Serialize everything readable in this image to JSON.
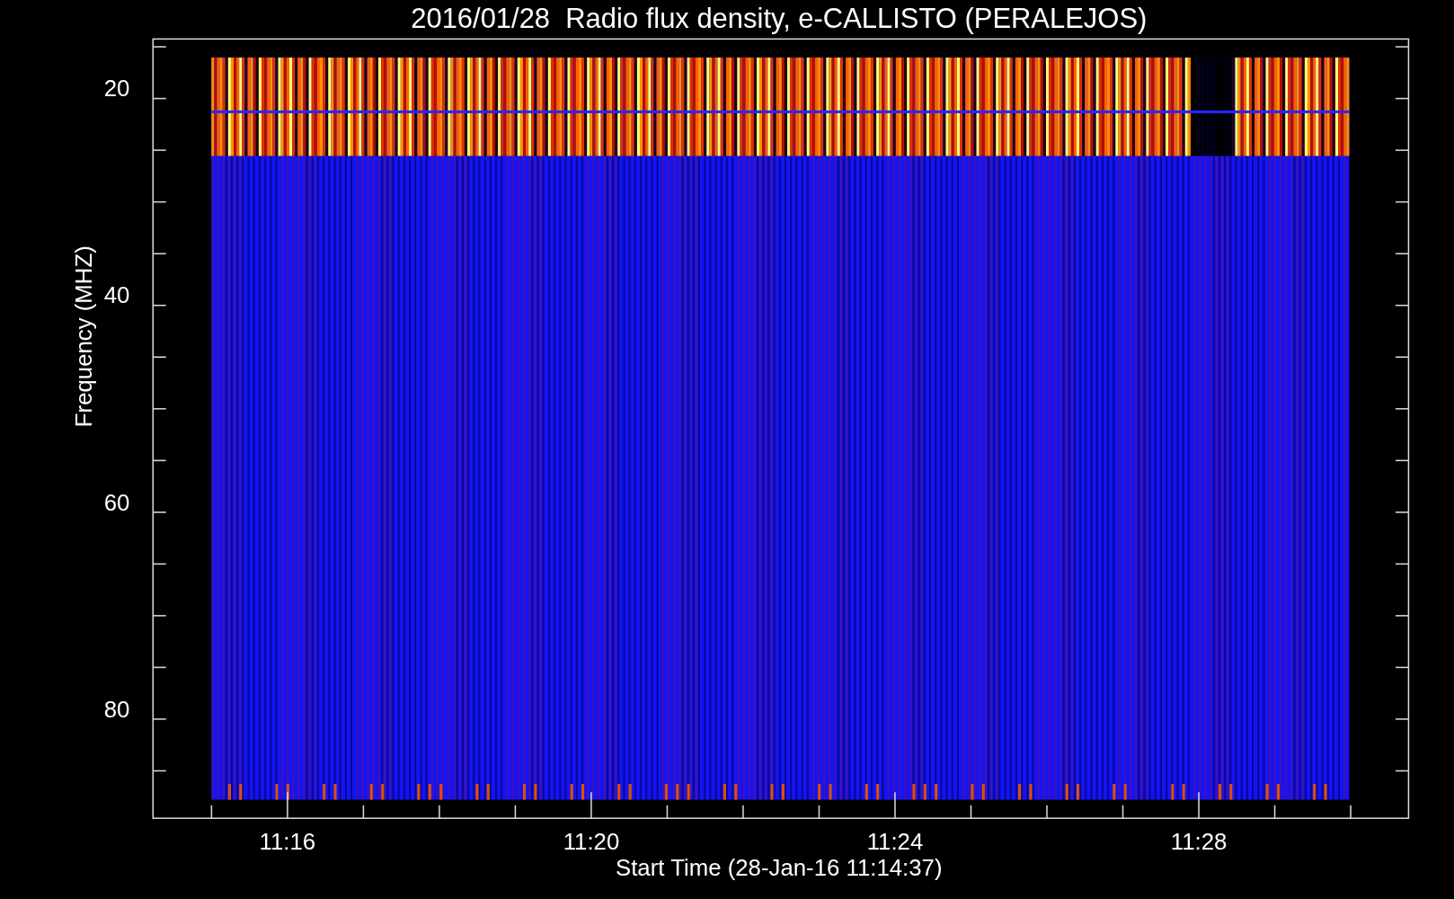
{
  "title": "2016/01/28  Radio flux density, e-CALLISTO (PERALEJOS)",
  "y_axis": {
    "label": "Frequency (MHZ)",
    "ticks": [
      "20",
      "40",
      "60",
      "80"
    ]
  },
  "x_axis": {
    "label": "Start Time (28-Jan-16 11:14:37)",
    "ticks": [
      "11:16",
      "11:20",
      "11:24",
      "11:28"
    ]
  }
}
